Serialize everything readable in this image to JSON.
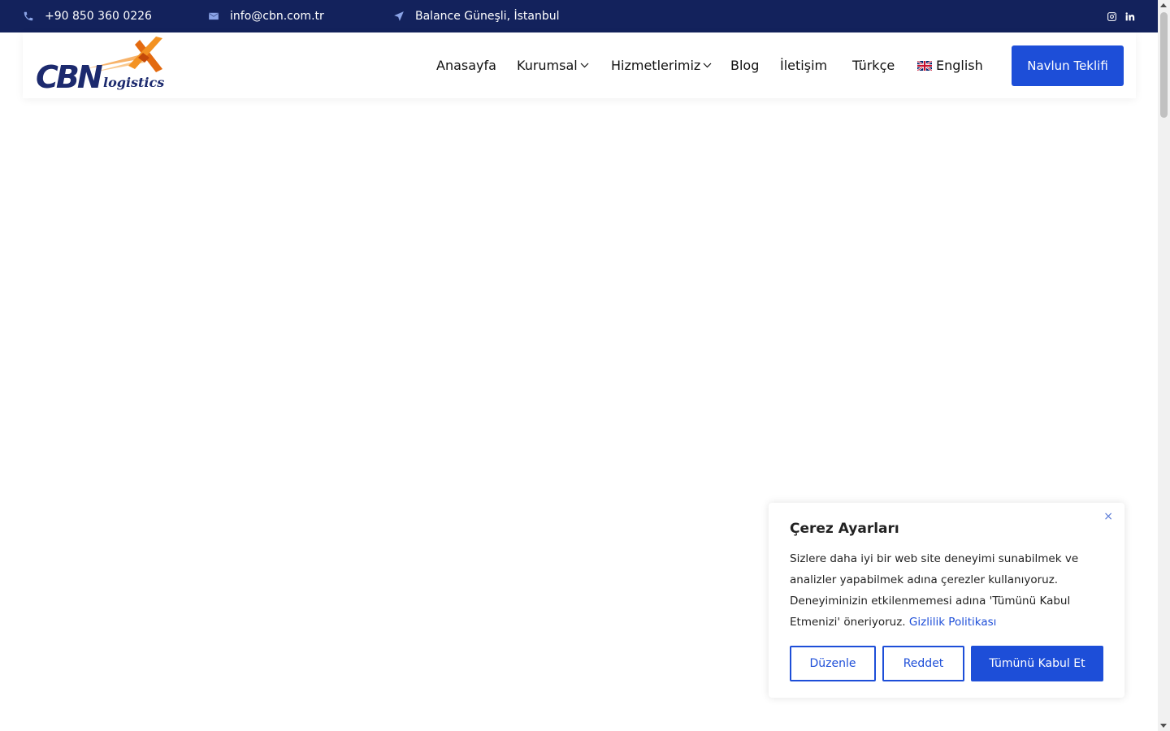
{
  "topbar": {
    "phone": "+90 850 360 0226",
    "email": "info@cbn.com.tr",
    "address": "Balance Güneşli, İstanbul",
    "socials": [
      "instagram-icon",
      "linkedin-icon"
    ]
  },
  "header": {
    "logo_main": "CBN",
    "logo_sub": "logistics",
    "nav": [
      {
        "label": "Anasayfa"
      },
      {
        "label": "Kurumsal"
      },
      {
        "label": "Hizmetlerimiz"
      },
      {
        "label": "Blog"
      },
      {
        "label": "İletişim"
      },
      {
        "label": "Türkçe"
      },
      {
        "label": "English"
      }
    ],
    "cta_label": "Navlun Teklifi"
  },
  "cookie": {
    "title": "Çerez Ayarları",
    "text": "Sizlere daha iyi bir web site deneyimi sunabilmek ve analizler yapabilmek adına çerezler kullanıyoruz. Deneyiminizin etkilenmemesi adına 'Tümünü Kabul Etmenizi' öneriyoruz.",
    "link": "Gizlilik Politikası",
    "close": "×",
    "buttons": {
      "edit": "Düzenle",
      "reject": "Reddet",
      "accept_all": "Tümünü Kabul Et"
    }
  },
  "colors": {
    "topbar_bg": "#13225c",
    "accent": "#1d4ed8",
    "logo_blue": "#1c2a6e",
    "logo_orange": "#f08a1c"
  }
}
